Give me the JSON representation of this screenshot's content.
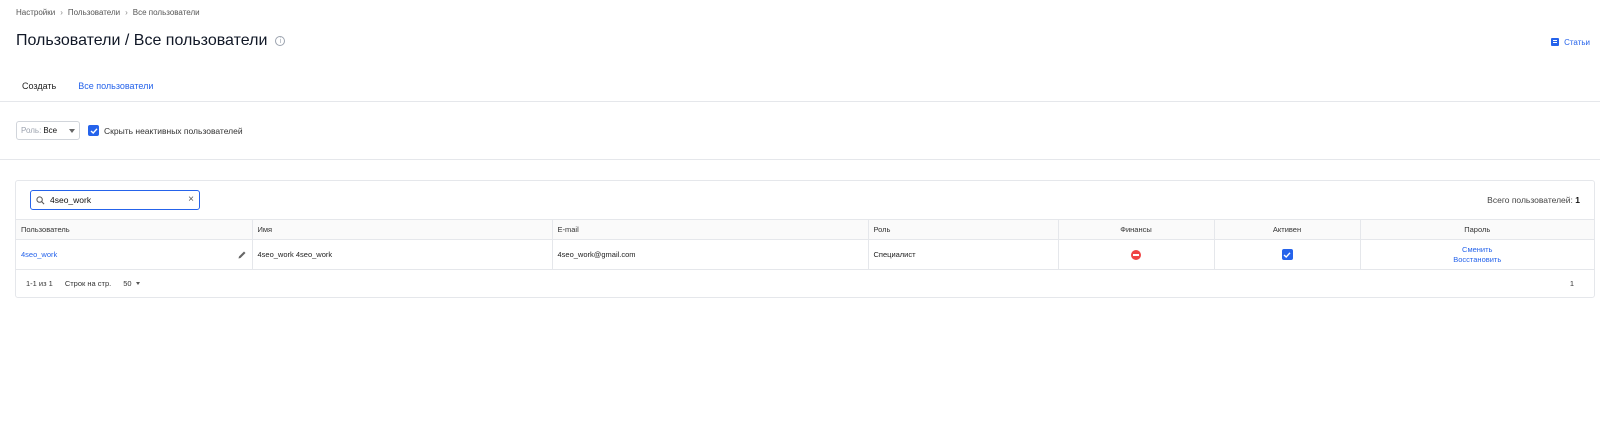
{
  "breadcrumb": [
    "Настройки",
    "Пользователи",
    "Все пользователи"
  ],
  "page_title": "Пользователи / Все пользователи",
  "articles_link": "Статьи",
  "tabs": [
    {
      "label": "Создать",
      "active": false
    },
    {
      "label": "Все пользователи",
      "active": true
    }
  ],
  "filters": {
    "role_label": "Роль:",
    "role_value": "Все",
    "hide_inactive_label": "Скрыть неактивных пользователей",
    "hide_inactive_checked": true
  },
  "search": {
    "value": "4seo_work"
  },
  "total": {
    "label": "Всего пользователей:",
    "count": "1"
  },
  "table": {
    "columns": [
      "Пользователь",
      "Имя",
      "E-mail",
      "Роль",
      "Финансы",
      "Активен",
      "Пароль"
    ],
    "rows": [
      {
        "user": "4seo_work",
        "name": "4seo_work 4seo_work",
        "email": "4seo_work@gmail.com",
        "role": "Специалист",
        "finance_icon": "minus-circle-icon",
        "active": true,
        "password_change": "Сменить",
        "password_restore": "Восстановить"
      }
    ]
  },
  "pagination": {
    "range": "1-1 из 1",
    "rows_per_page_label": "Строк на стр.",
    "rows_per_page_value": "50",
    "page": "1"
  },
  "colors": {
    "accent": "#2563eb",
    "danger": "#ef4444",
    "border": "#e5e7eb"
  }
}
